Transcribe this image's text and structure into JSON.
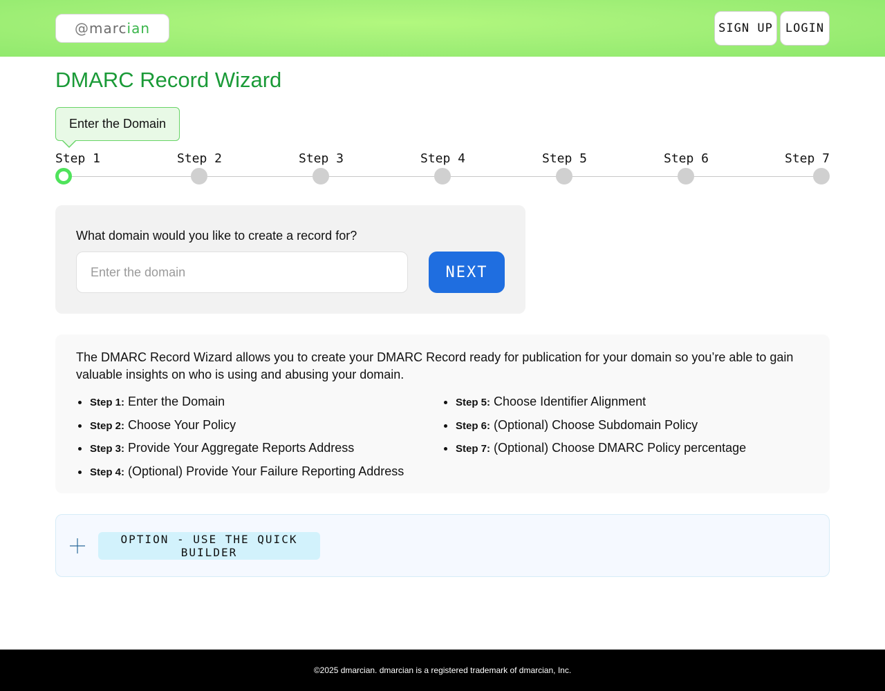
{
  "header": {
    "logo_text_prefix": "@",
    "logo_text_a": "marc",
    "logo_text_b": "ian",
    "signup_label": "SIGN UP",
    "login_label": "LOGIN"
  },
  "page": {
    "title": "DMARC Record Wizard"
  },
  "tooltip": {
    "text": "Enter the Domain"
  },
  "stepper": {
    "active_step": 1,
    "steps": [
      {
        "label": "Step 1"
      },
      {
        "label": "Step 2"
      },
      {
        "label": "Step 3"
      },
      {
        "label": "Step 4"
      },
      {
        "label": "Step 5"
      },
      {
        "label": "Step 6"
      },
      {
        "label": "Step 7"
      }
    ]
  },
  "domain_form": {
    "question": "What domain would you like to create a record for?",
    "input_value": "",
    "input_placeholder": "Enter the domain",
    "next_label": "NEXT"
  },
  "info": {
    "description": "The DMARC Record Wizard allows you to create your DMARC Record ready for publication for your domain so you’re able to gain valuable insights on who is using and abusing your domain.",
    "left_steps": [
      {
        "key": "Step 1:",
        "text": "Enter the Domain"
      },
      {
        "key": "Step 2:",
        "text": "Choose Your Policy"
      },
      {
        "key": "Step 3:",
        "text": "Provide Your Aggregate Reports Address"
      },
      {
        "key": "Step 4:",
        "text": "(Optional) Provide Your Failure Reporting Address"
      }
    ],
    "right_steps": [
      {
        "key": "Step 5:",
        "text": "Choose Identifier Alignment"
      },
      {
        "key": "Step 6:",
        "text": "(Optional) Choose Subdomain Policy"
      },
      {
        "key": "Step 7:",
        "text": "(Optional) Choose DMARC Policy percentage"
      }
    ]
  },
  "quick_builder": {
    "label": "OPTION - USE THE QUICK BUILDER",
    "icon": "plus-icon"
  },
  "footer": {
    "text": "©2025 dmarcian. dmarcian is a registered trademark of dmarcian, Inc."
  },
  "colors": {
    "brand_green": "#1a9a37",
    "header_green": "#a6f17a",
    "active_step": "#4fe35b",
    "primary_button": "#1f6ee0"
  }
}
